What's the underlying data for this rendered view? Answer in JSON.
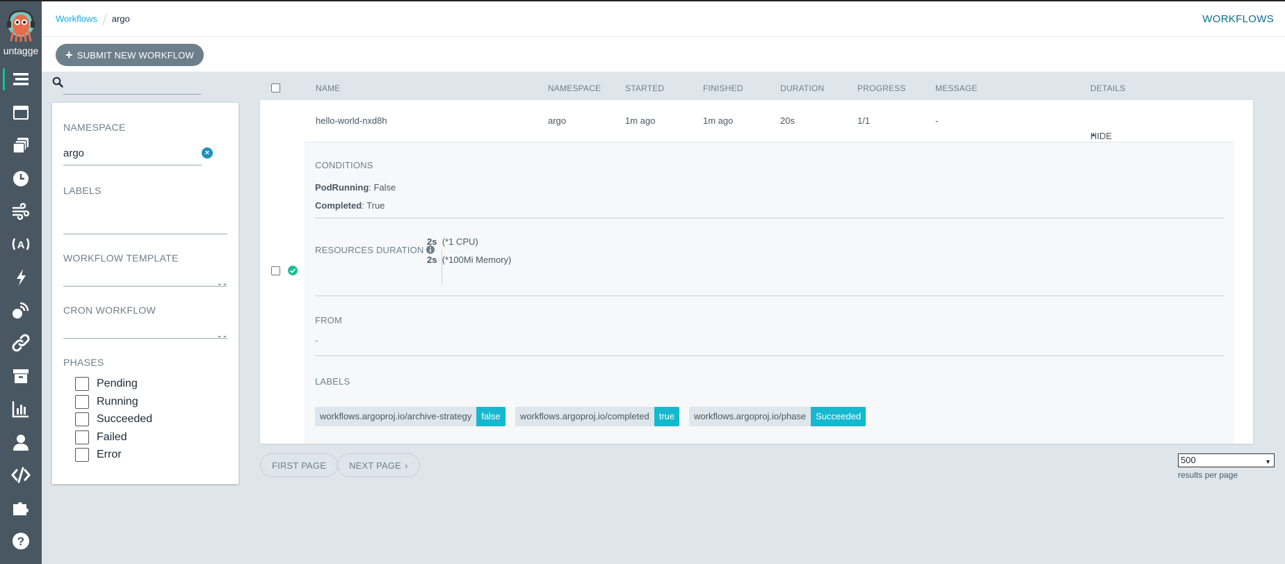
{
  "nav": {
    "user": "untagge",
    "items": [
      "workflows-icon",
      "workflow-templates-icon",
      "cluster-templates-icon",
      "cron-workflows-icon",
      "event-flow-icon",
      "event-sources-icon",
      "sensors-icon",
      "event-bindings-icon",
      "pipelines-icon",
      "archived-workflows-icon",
      "reports-icon",
      "user-icon",
      "api-docs-icon",
      "plugins-icon",
      "help-icon"
    ]
  },
  "breadcrumb": {
    "root": "Workflows",
    "current": "argo"
  },
  "header": {
    "title": "WORKFLOWS"
  },
  "toolbar": {
    "submit_label": "SUBMIT NEW WORKFLOW"
  },
  "filters": {
    "search_value": "",
    "namespace_label": "NAMESPACE",
    "namespace_value": "argo",
    "labels_label": "LABELS",
    "workflow_template_label": "WORKFLOW TEMPLATE",
    "cron_workflow_label": "CRON WORKFLOW",
    "phases_label": "PHASES",
    "phases": [
      "Pending",
      "Running",
      "Succeeded",
      "Failed",
      "Error"
    ]
  },
  "table": {
    "columns": [
      "NAME",
      "NAMESPACE",
      "STARTED",
      "FINISHED",
      "DURATION",
      "PROGRESS",
      "MESSAGE",
      "DETAILS"
    ],
    "row": {
      "name": "hello-world-nxd8h",
      "namespace": "argo",
      "started": "1m ago",
      "finished": "1m ago",
      "duration": "20s",
      "progress": "1/1",
      "message": "-",
      "details": "HIDE"
    }
  },
  "details": {
    "conditions_label": "CONDITIONS",
    "conditions": [
      {
        "key": "PodRunning",
        "value": ": False"
      },
      {
        "key": "Completed",
        "value": ": True"
      }
    ],
    "resources_label": "RESOURCES DURATION",
    "resources": [
      {
        "value": "2s",
        "unit": "(*1 CPU)"
      },
      {
        "value": "2s",
        "unit": "(*100Mi Memory)"
      }
    ],
    "from_label": "FROM",
    "from_value": "-",
    "labels_label": "LABELS",
    "labels": [
      {
        "key": "workflows.argoproj.io/archive-strategy",
        "value": "false"
      },
      {
        "key": "workflows.argoproj.io/completed",
        "value": "true"
      },
      {
        "key": "workflows.argoproj.io/phase",
        "value": "Succeeded"
      }
    ]
  },
  "pager": {
    "first_label": "FIRST PAGE",
    "next_label": "NEXT PAGE",
    "per_page": "500",
    "per_page_label": "results per page"
  },
  "colors": {
    "nav_bg": "#495762",
    "accent": "#0dadea",
    "tag_value": "#14b8cf",
    "success": "#18be94"
  }
}
